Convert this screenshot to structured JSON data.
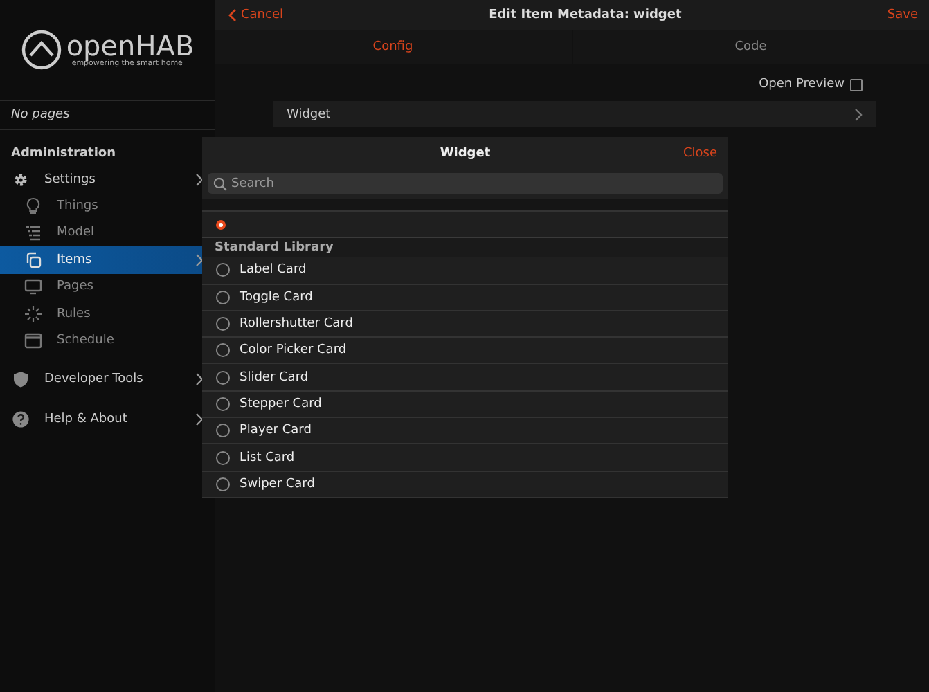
{
  "sidebar": {
    "logo": {
      "name": "openHAB",
      "tagline": "empowering the smart home"
    },
    "pages_note": "No pages",
    "section_title": "Administration",
    "items": [
      {
        "label": "Settings",
        "selected": false,
        "submenu": true,
        "children": [
          {
            "label": "Things",
            "selected": false,
            "submenu": false
          },
          {
            "label": "Model",
            "selected": false,
            "submenu": false
          },
          {
            "label": "Items",
            "selected": true,
            "submenu": true
          },
          {
            "label": "Pages",
            "selected": false,
            "submenu": false
          },
          {
            "label": "Rules",
            "selected": false,
            "submenu": false
          },
          {
            "label": "Schedule",
            "selected": false,
            "submenu": false
          }
        ]
      },
      {
        "label": "Developer Tools",
        "selected": false,
        "submenu": true
      },
      {
        "label": "Help & About",
        "selected": false,
        "submenu": true
      }
    ]
  },
  "navbar": {
    "back": "Cancel",
    "title": "Edit Item Metadata: widget",
    "action": "Save"
  },
  "tabs": [
    {
      "label": "Config",
      "selected": true
    },
    {
      "label": "Code",
      "selected": false
    }
  ],
  "open_preview": {
    "label": "Open Preview",
    "checked": false
  },
  "list_row": "Widget",
  "modal": {
    "title": "Widget",
    "close": "Close",
    "search": {
      "placeholder": "Search"
    },
    "options": [
      {
        "selected": true
      }
    ],
    "groups": [
      {
        "title": "Standard Library",
        "options": [
          {
            "label": "Label Card",
            "selected": false
          },
          {
            "label": "Toggle Card",
            "selected": false
          },
          {
            "label": "Rollershutter Card",
            "selected": false
          },
          {
            "label": "Color Picker Card",
            "selected": false
          },
          {
            "label": "Slider Card",
            "selected": false
          },
          {
            "label": "Stepper Card",
            "selected": false
          },
          {
            "label": "Player Card",
            "selected": false
          },
          {
            "label": "List Card",
            "selected": false
          },
          {
            "label": "Swiper Card",
            "selected": false
          }
        ]
      }
    ]
  }
}
